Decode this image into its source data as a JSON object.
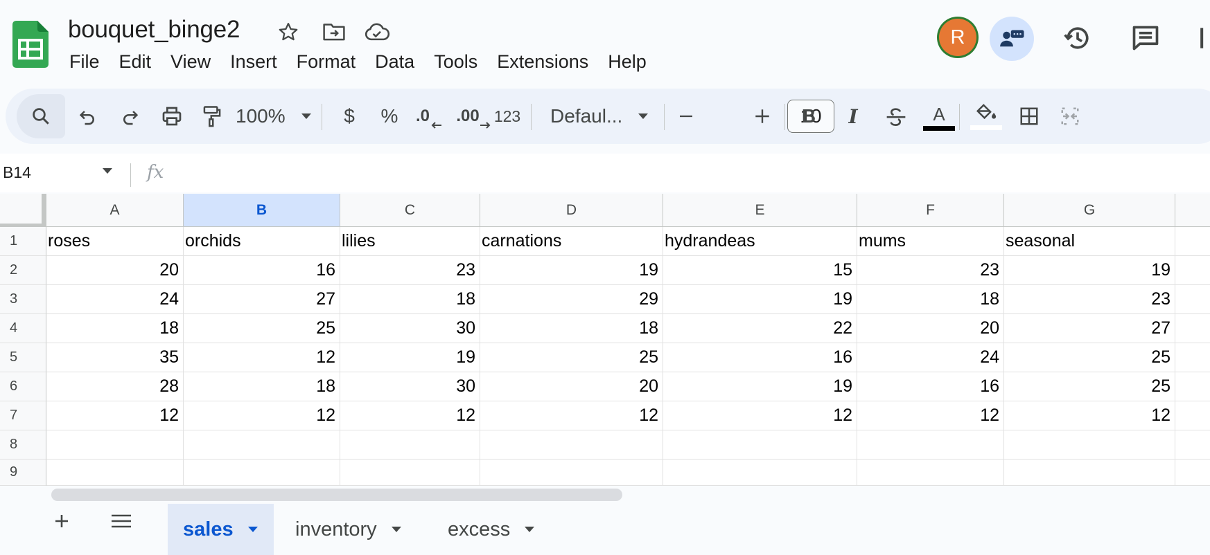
{
  "doc": {
    "title": "bouquet_binge2"
  },
  "menu": [
    "File",
    "Edit",
    "View",
    "Insert",
    "Format",
    "Data",
    "Tools",
    "Extensions",
    "Help"
  ],
  "user": {
    "avatar_letter": "R",
    "avatar_color": "#e67834"
  },
  "toolbar": {
    "zoom": "100%",
    "currency": "$",
    "percent": "%",
    "dec_decrease": ".0",
    "dec_increase": ".00",
    "number_format": "123",
    "font": "Defaul...",
    "font_size": "10",
    "bold": "B",
    "italic": "I",
    "text_color_letter": "A"
  },
  "formula_bar": {
    "name_box": "B14",
    "fx": "fx",
    "value": ""
  },
  "grid": {
    "selected_column": "B",
    "columns": [
      "A",
      "B",
      "C",
      "D",
      "E",
      "F",
      "G"
    ],
    "row_numbers": [
      "1",
      "2",
      "3",
      "4",
      "5",
      "6",
      "7",
      "8",
      "9"
    ],
    "rows": [
      [
        "roses",
        "orchids",
        "lilies",
        "carnations",
        "hydrandeas",
        "mums",
        "seasonal"
      ],
      [
        "20",
        "16",
        "23",
        "19",
        "15",
        "23",
        "19"
      ],
      [
        "24",
        "27",
        "18",
        "29",
        "19",
        "18",
        "23"
      ],
      [
        "18",
        "25",
        "30",
        "18",
        "22",
        "20",
        "27"
      ],
      [
        "35",
        "12",
        "19",
        "25",
        "16",
        "24",
        "25"
      ],
      [
        "28",
        "18",
        "30",
        "20",
        "19",
        "16",
        "25"
      ],
      [
        "12",
        "12",
        "12",
        "12",
        "12",
        "12",
        "12"
      ],
      [
        "",
        "",
        "",
        "",
        "",
        "",
        ""
      ],
      [
        "",
        "",
        "",
        "",
        "",
        "",
        ""
      ]
    ]
  },
  "sheets": {
    "tabs": [
      "sales",
      "inventory",
      "excess"
    ],
    "active": "sales"
  },
  "colors": {
    "brand_green": "#34a853",
    "accent_blue": "#0b57d0",
    "selected_header": "#d3e3fd"
  }
}
